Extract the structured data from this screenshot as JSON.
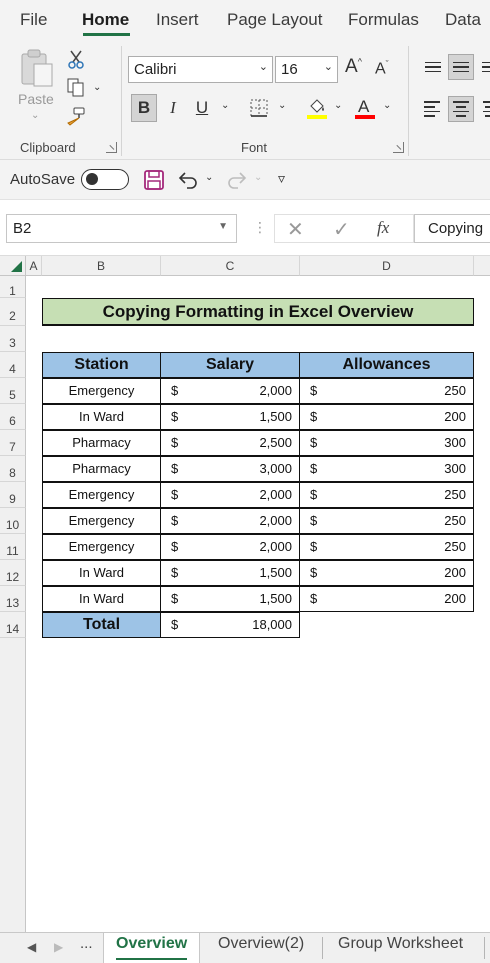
{
  "ribbon_tabs": [
    {
      "label": "File"
    },
    {
      "label": "Home"
    },
    {
      "label": "Insert"
    },
    {
      "label": "Page Layout"
    },
    {
      "label": "Formulas"
    },
    {
      "label": "Data"
    }
  ],
  "active_tab": "Home",
  "clipboard": {
    "paste_label": "Paste",
    "group_label": "Clipboard"
  },
  "font": {
    "font_name": "Calibri",
    "font_size": "16",
    "group_label": "Font",
    "bold_pressed": true,
    "highlight_color": "#ffff00",
    "font_color": "#ff0000"
  },
  "qat": {
    "autosave_label": "AutoSave",
    "autosave_on": false
  },
  "formula_bar": {
    "name_box": "B2",
    "fx_label": "fx",
    "formula_value": "Copying"
  },
  "grid": {
    "columns": [
      "A",
      "B",
      "C",
      "D"
    ],
    "rows": [
      "1",
      "2",
      "3",
      "4",
      "5",
      "6",
      "7",
      "8",
      "9",
      "10",
      "11",
      "12",
      "13",
      "14"
    ]
  },
  "sheet": {
    "title": "Copying Formatting in Excel Overview",
    "headers": [
      "Station",
      "Salary",
      "Allowances"
    ],
    "currency_symbol": "$",
    "rows": [
      {
        "station": "Emergency",
        "salary": "2,000",
        "allowance": "250"
      },
      {
        "station": "In Ward",
        "salary": "1,500",
        "allowance": "200"
      },
      {
        "station": "Pharmacy",
        "salary": "2,500",
        "allowance": "300"
      },
      {
        "station": "Pharmacy",
        "salary": "3,000",
        "allowance": "300"
      },
      {
        "station": "Emergency",
        "salary": "2,000",
        "allowance": "250"
      },
      {
        "station": "Emergency",
        "salary": "2,000",
        "allowance": "250"
      },
      {
        "station": "Emergency",
        "salary": "2,000",
        "allowance": "250"
      },
      {
        "station": "In Ward",
        "salary": "1,500",
        "allowance": "200"
      },
      {
        "station": "In Ward",
        "salary": "1,500",
        "allowance": "200"
      }
    ],
    "total_label": "Total",
    "total_salary": "18,000",
    "header_fill": "#9dc3e6",
    "title_fill": "#c6dfb4"
  },
  "sheet_tabs": {
    "ellipsis": "...",
    "tabs": [
      {
        "label": "Overview"
      },
      {
        "label": "Overview(2)"
      },
      {
        "label": "Group Worksheet"
      }
    ],
    "active": "Overview"
  }
}
